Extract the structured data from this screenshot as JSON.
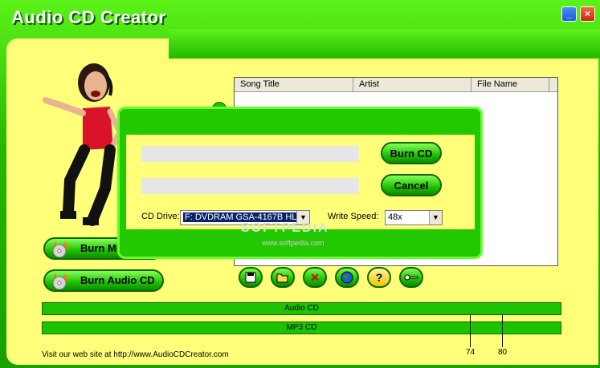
{
  "window": {
    "title": "Audio CD Creator",
    "minimize_glyph": "_",
    "close_glyph": "×"
  },
  "song_list": {
    "columns": [
      "Song Title",
      "Artist",
      "File Name"
    ]
  },
  "dialog": {
    "burn_label": "Burn CD",
    "cancel_label": "Cancel",
    "cd_drive_label": "CD Drive:",
    "cd_drive_value": "F: DVDRAM GSA-4167B HL-",
    "write_speed_label": "Write Speed:",
    "write_speed_value": "48x"
  },
  "left_buttons": {
    "burn_mp3_label": "Burn MP3",
    "burn_audio_label": "Burn Audio CD"
  },
  "toolbar": {
    "icons": [
      "save-icon",
      "open-folder-icon",
      "delete-icon",
      "globe-icon",
      "help-icon",
      "key-icon"
    ],
    "delete_glyph": "✕",
    "help_glyph": "?"
  },
  "bars": {
    "audio_label": "Audio CD",
    "mp3_label": "MP3 CD",
    "tick_74": "74",
    "tick_80": "80"
  },
  "footer": {
    "text": "Visit our web site at http://www.AudioCDCreator.com"
  },
  "watermark": {
    "line1": "SOFTPEDIA",
    "line2": "www.softpedia.com"
  },
  "colors": {
    "frame_green": "#24b800",
    "panel_yellow": "#ffff7a",
    "button_green": "#20c000"
  }
}
